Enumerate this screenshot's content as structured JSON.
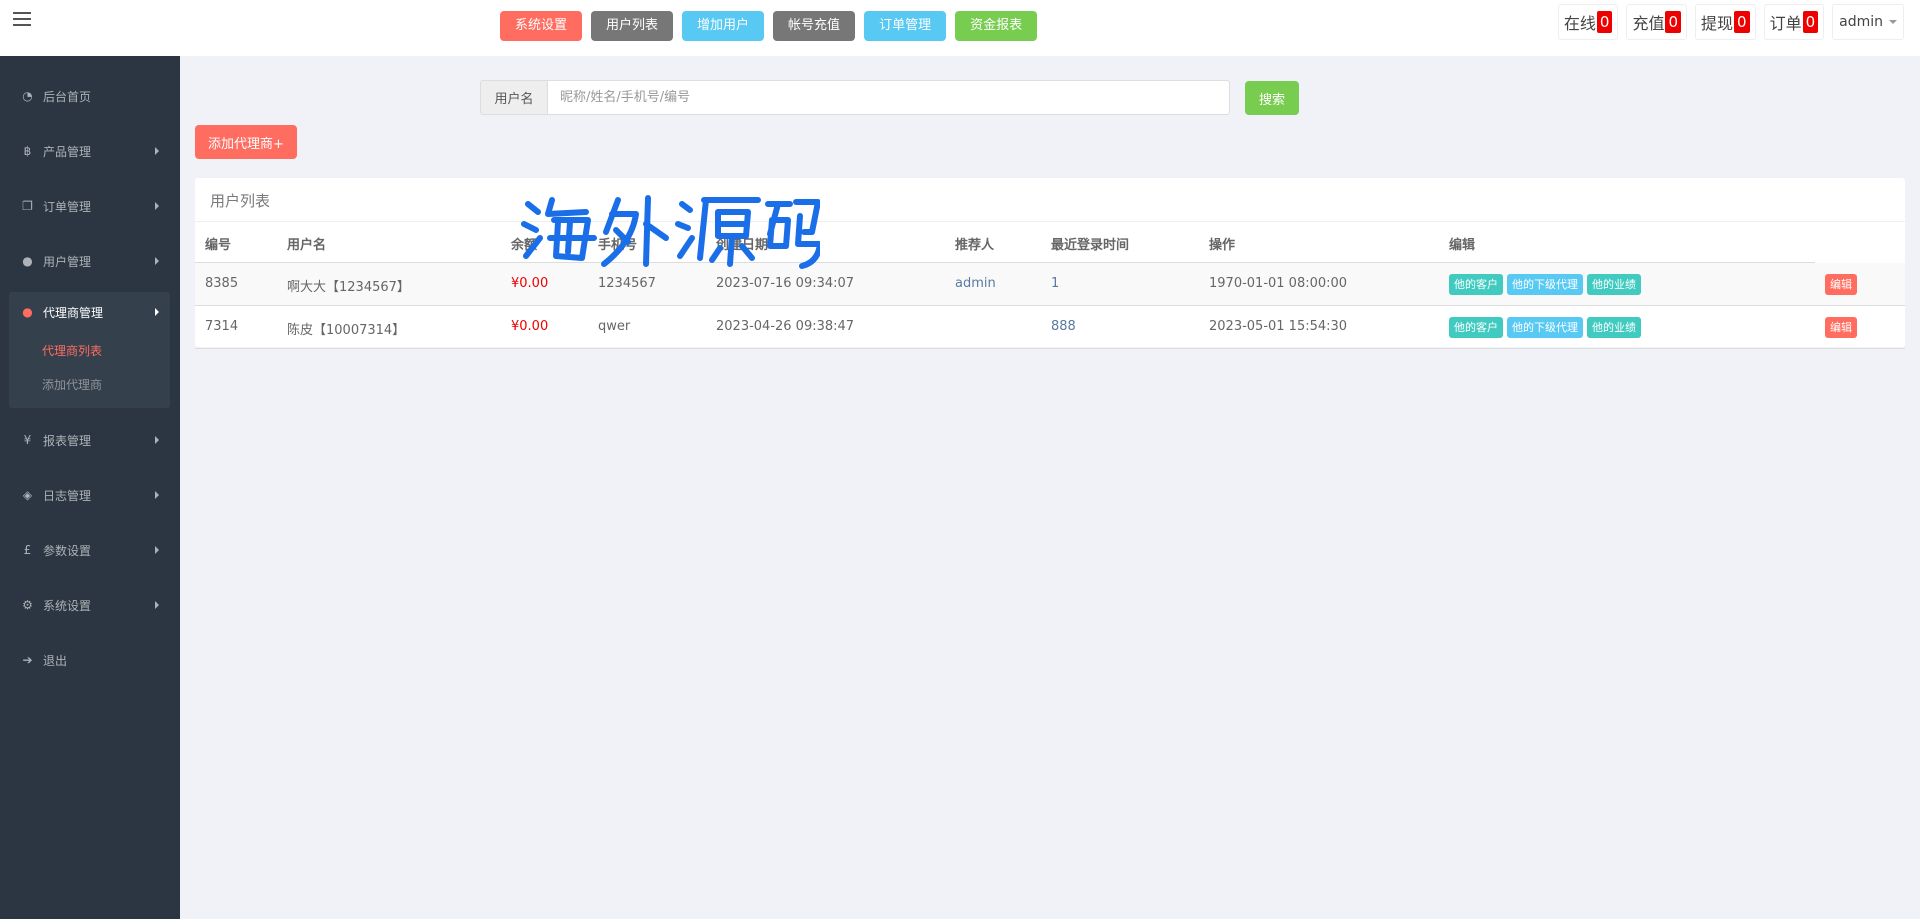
{
  "topnav": [
    {
      "label": "系统设置",
      "color": "#ff6c60"
    },
    {
      "label": "用户列表",
      "color": "#777777"
    },
    {
      "label": "增加用户",
      "color": "#58c9f3"
    },
    {
      "label": "帐号充值",
      "color": "#777777"
    },
    {
      "label": "订单管理",
      "color": "#58c9f3"
    },
    {
      "label": "资金报表",
      "color": "#78cd51"
    }
  ],
  "stats": [
    {
      "label": "在线",
      "count": "0"
    },
    {
      "label": "充值",
      "count": "0"
    },
    {
      "label": "提现",
      "count": "0"
    },
    {
      "label": "订单",
      "count": "0"
    }
  ],
  "user": {
    "name": "admin"
  },
  "sidebar": {
    "items": [
      {
        "label": "后台首页",
        "icon": "dashboard-icon"
      },
      {
        "label": "产品管理",
        "icon": "bitcoin-icon"
      },
      {
        "label": "订单管理",
        "icon": "files-icon"
      },
      {
        "label": "用户管理",
        "icon": "user-icon"
      },
      {
        "label": "代理商管理",
        "icon": "agent-icon"
      },
      {
        "label": "报表管理",
        "icon": "yen-icon"
      },
      {
        "label": "日志管理",
        "icon": "ticket-icon"
      },
      {
        "label": "参数设置",
        "icon": "pound-icon"
      },
      {
        "label": "系统设置",
        "icon": "gears-icon"
      },
      {
        "label": "退出",
        "icon": "sign-out-icon"
      }
    ],
    "submenu": [
      {
        "label": "代理商列表"
      },
      {
        "label": "添加代理商"
      }
    ]
  },
  "search": {
    "addon": "用户名",
    "placeholder": "昵称/姓名/手机号/编号",
    "button": "搜索"
  },
  "add_button": "添加代理商+",
  "panel_title": "用户列表",
  "table": {
    "headers": [
      "编号",
      "用户名",
      "余额",
      "手机号",
      "创建日期",
      "推荐人",
      "最近登录时间",
      "操作",
      "编辑"
    ],
    "rows": [
      {
        "id": "8385",
        "username": "啊大大【1234567】",
        "balance": "¥0.00",
        "phone": "1234567",
        "created": "2023-07-16 09:34:07",
        "referrer": "admin",
        "last_login_ip": "1",
        "last_login": "1970-01-01 08:00:00"
      },
      {
        "id": "7314",
        "username": "陈皮【10007314】",
        "balance": "¥0.00",
        "phone": "qwer",
        "created": "2023-04-26 09:38:47",
        "referrer": "",
        "last_login_ip": "888",
        "last_login": "2023-05-01 15:54:30"
      }
    ],
    "op_labels": [
      "他的客户",
      "他的下级代理",
      "他的业绩"
    ],
    "edit_label": "编辑"
  },
  "watermark": "海外源码"
}
